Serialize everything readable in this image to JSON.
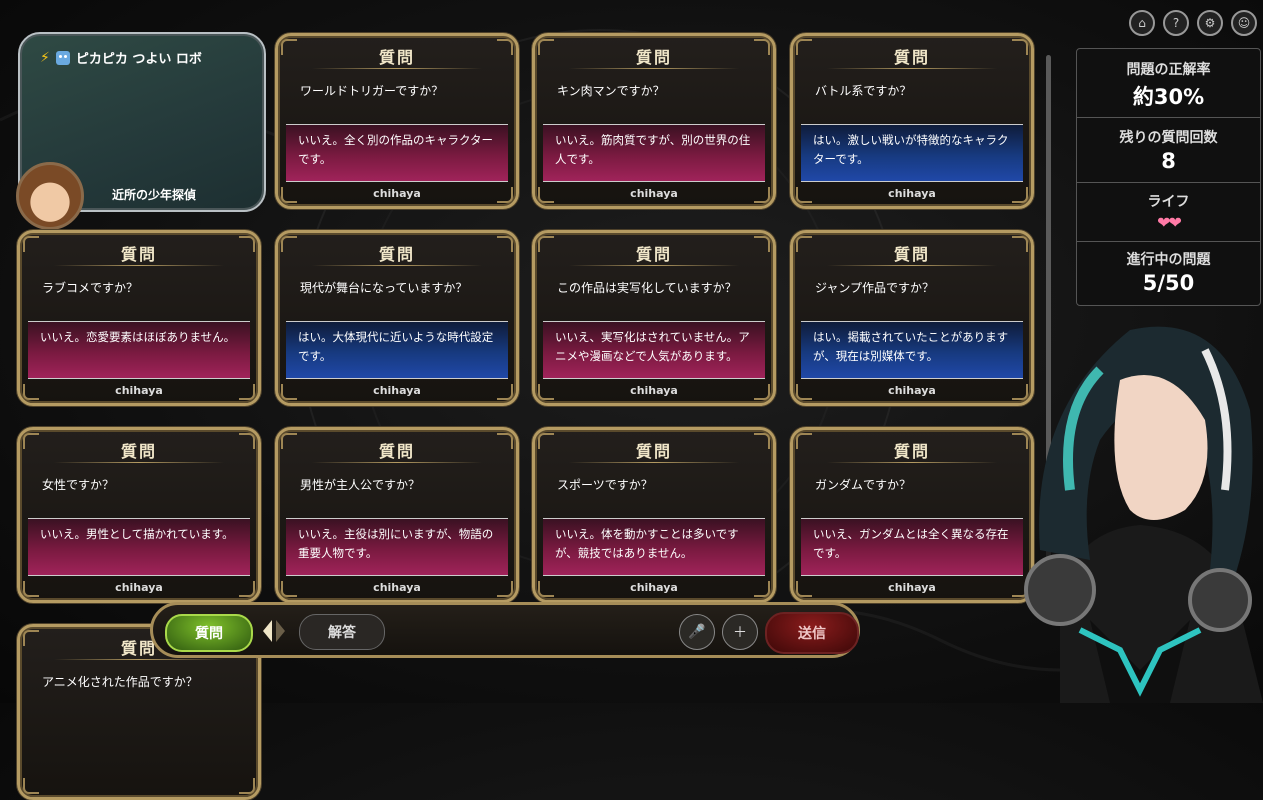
{
  "character": {
    "title": "ピカピカ つよい ロボ",
    "name": "近所の少年探偵"
  },
  "cards": [
    {
      "heading": "質問",
      "question": "ワールドトリガーですか？",
      "answer": "いいえ。全く別の作品のキャラクターです。",
      "type": "no",
      "author": "chihaya"
    },
    {
      "heading": "質問",
      "question": "キン肉マンですか？",
      "answer": "いいえ。筋肉質ですが、別の世界の住人です。",
      "type": "no",
      "author": "chihaya"
    },
    {
      "heading": "質問",
      "question": "バトル系ですか？",
      "answer": "はい。激しい戦いが特徴的なキャラクターです。",
      "type": "yes",
      "author": "chihaya"
    },
    {
      "heading": "質問",
      "question": "ラブコメですか？",
      "answer": "いいえ。恋愛要素はほぼありません。",
      "type": "no",
      "author": "chihaya"
    },
    {
      "heading": "質問",
      "question": "現代が舞台になっていますか？",
      "answer": "はい。大体現代に近いような時代設定です。",
      "type": "yes",
      "author": "chihaya"
    },
    {
      "heading": "質問",
      "question": "この作品は実写化していますか？",
      "answer": "いいえ、実写化はされていません。アニメや漫画などで人気があります。",
      "type": "no",
      "author": "chihaya"
    },
    {
      "heading": "質問",
      "question": "ジャンプ作品ですか？",
      "answer": "はい。掲載されていたことがありますが、現在は別媒体です。",
      "type": "yes",
      "author": "chihaya"
    },
    {
      "heading": "質問",
      "question": "女性ですか？",
      "answer": "いいえ。男性として描かれています。",
      "type": "no",
      "author": "chihaya"
    },
    {
      "heading": "質問",
      "question": "男性が主人公ですか？",
      "answer": "いいえ。主役は別にいますが、物語の重要人物です。",
      "type": "no",
      "author": "chihaya"
    },
    {
      "heading": "質問",
      "question": "スポーツですか？",
      "answer": "いいえ。体を動かすことは多いですが、競技ではありません。",
      "type": "no",
      "author": "chihaya"
    },
    {
      "heading": "質問",
      "question": "ガンダムですか？",
      "answer": "いいえ、ガンダムとは全く異なる存在です。",
      "type": "no",
      "author": "chihaya"
    },
    {
      "heading": "質問",
      "question": "アニメ化された作品ですか？",
      "answer": "",
      "type": "no",
      "author": ""
    }
  ],
  "stats": {
    "accuracy_label": "問題の正解率",
    "accuracy_value": "約30%",
    "remaining_label": "残りの質問回数",
    "remaining_value": "8",
    "life_label": "ライフ",
    "life_hearts": "❤❤",
    "progress_label": "進行中の問題",
    "progress_value": "5/50"
  },
  "input_bar": {
    "question_label": "質問",
    "answer_label": "解答",
    "input_value": "",
    "input_placeholder": "",
    "send_label": "送信"
  },
  "icons": {
    "home": "home-icon",
    "help": "help-icon",
    "settings": "gear-icon",
    "discord": "discord-icon"
  }
}
